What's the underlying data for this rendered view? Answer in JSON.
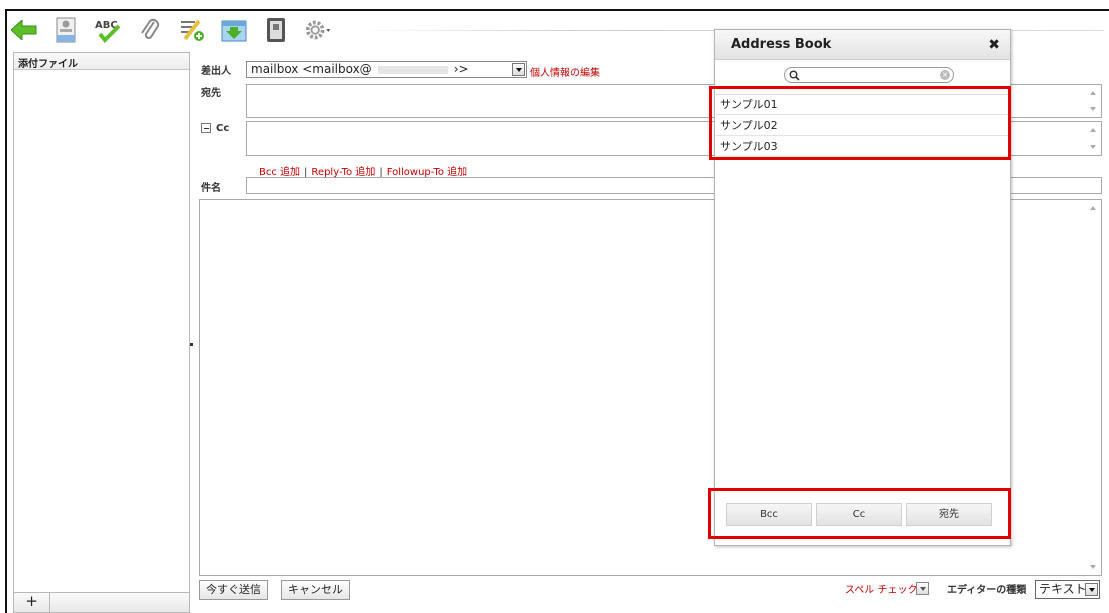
{
  "toolbar": {
    "buttons": [
      {
        "icon": "back-arrow-icon"
      },
      {
        "icon": "sender-icon"
      },
      {
        "icon": "spellcheck-icon",
        "text": "ABC"
      },
      {
        "icon": "paperclip-icon"
      },
      {
        "icon": "add-contacts-icon"
      },
      {
        "icon": "save-download-icon"
      },
      {
        "icon": "address-book-icon"
      },
      {
        "icon": "gear-icon"
      }
    ]
  },
  "attachments": {
    "header": "添付ファイル",
    "add_label": "+"
  },
  "form": {
    "from_label": "差出人",
    "from_value_start": "mailbox <mailbox@",
    "from_value_end": "›>",
    "edit_profile_link": "個人情報の編集",
    "to_label": "宛先",
    "cc_label": "Cc",
    "links": {
      "bcc": "Bcc 追加",
      "reply_to": "Reply-To 追加",
      "followup_to": "Followup-To 追加",
      "separator": "|"
    },
    "subject_label": "件名"
  },
  "footer": {
    "send_now": "今すぐ送信",
    "cancel": "キャンセル",
    "spell_check": "スペル チェック",
    "editor_type_label": "エディターの種類",
    "editor_type_value": "テキスト"
  },
  "address_book": {
    "title": "Address Book",
    "close_glyph": "✖",
    "search_value": "",
    "entries": [
      "サンプル01",
      "サンプル02",
      "サンプル03"
    ],
    "buttons": {
      "bcc": "Bcc",
      "cc": "Cc",
      "to": "宛先"
    }
  },
  "colors": {
    "highlight": "#e00000",
    "link_red": "#c00000"
  }
}
